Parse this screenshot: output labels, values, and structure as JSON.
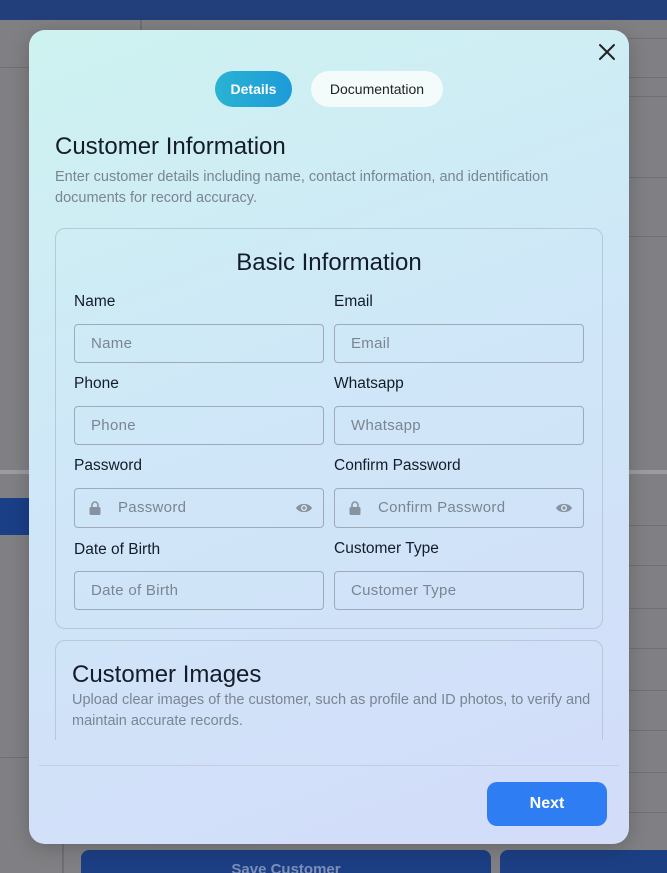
{
  "background": {
    "save_button_label": "Save Customer"
  },
  "modal": {
    "tabs": [
      {
        "label": "Details",
        "active": true
      },
      {
        "label": "Documentation",
        "active": false
      }
    ],
    "section": {
      "title": "Customer Information",
      "description": "Enter customer details including name, contact information, and identification documents for record accuracy."
    },
    "basic_info": {
      "title": "Basic Information",
      "fields": {
        "name": {
          "label": "Name",
          "placeholder": "Name"
        },
        "email": {
          "label": "Email",
          "placeholder": "Email"
        },
        "phone": {
          "label": "Phone",
          "placeholder": "Phone"
        },
        "whatsapp": {
          "label": "Whatsapp",
          "placeholder": "Whatsapp"
        },
        "password": {
          "label": "Password",
          "placeholder": "Password"
        },
        "confirm_password": {
          "label": "Confirm Password",
          "placeholder": "Confirm Password"
        },
        "dob": {
          "label": "Date of Birth",
          "placeholder": "Date of Birth"
        },
        "customer_type": {
          "label": "Customer Type",
          "placeholder": "Customer Type"
        }
      }
    },
    "images": {
      "title": "Customer Images",
      "description": "Upload clear images of the customer, such as profile and ID photos, to verify and maintain accurate records."
    },
    "next_label": "Next"
  },
  "colors": {
    "accent": "#2f7df3",
    "tab_active": "#1d9bd8",
    "topbar": "#223f7c"
  },
  "icons": {
    "close": "close-icon",
    "lock": "lock-icon",
    "eye": "eye-icon"
  }
}
